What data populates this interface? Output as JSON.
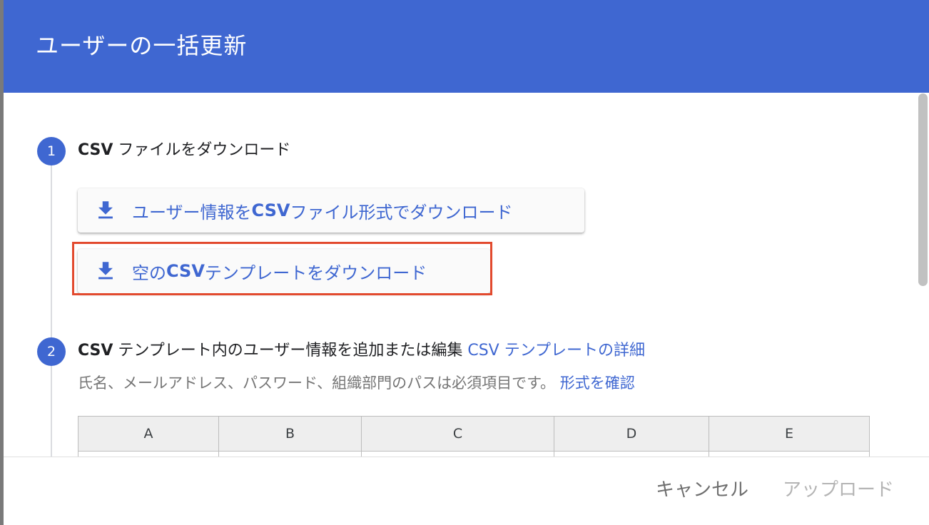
{
  "dialog": {
    "title": "ユーザーの一括更新"
  },
  "step1": {
    "number": "1",
    "title_bold": "CSV",
    "title_rest": " ファイルをダウンロード",
    "buttons": [
      {
        "icon": "download-icon",
        "label_pre": "ユーザー情報を ",
        "label_bold": "CSV",
        "label_post": " ファイル形式でダウンロード"
      },
      {
        "icon": "download-icon",
        "label_pre": "空の ",
        "label_bold": "CSV",
        "label_post": " テンプレートをダウンロード"
      }
    ]
  },
  "step2": {
    "number": "2",
    "title_bold": "CSV",
    "title_rest": " テンプレート内のユーザー情報を追加または編集 ",
    "title_link": "CSV テンプレートの詳細",
    "subtitle": "氏名、メールアドレス、パスワード、組織部門のパスは必須項目です。 ",
    "subtitle_link": "形式を確認",
    "table_headers": [
      "A",
      "B",
      "C",
      "D",
      "E"
    ]
  },
  "footer": {
    "cancel_label": "キャンセル",
    "upload_label": "アップロード"
  },
  "colors": {
    "accent": "#3f67d1",
    "highlight": "#e24a2e"
  }
}
